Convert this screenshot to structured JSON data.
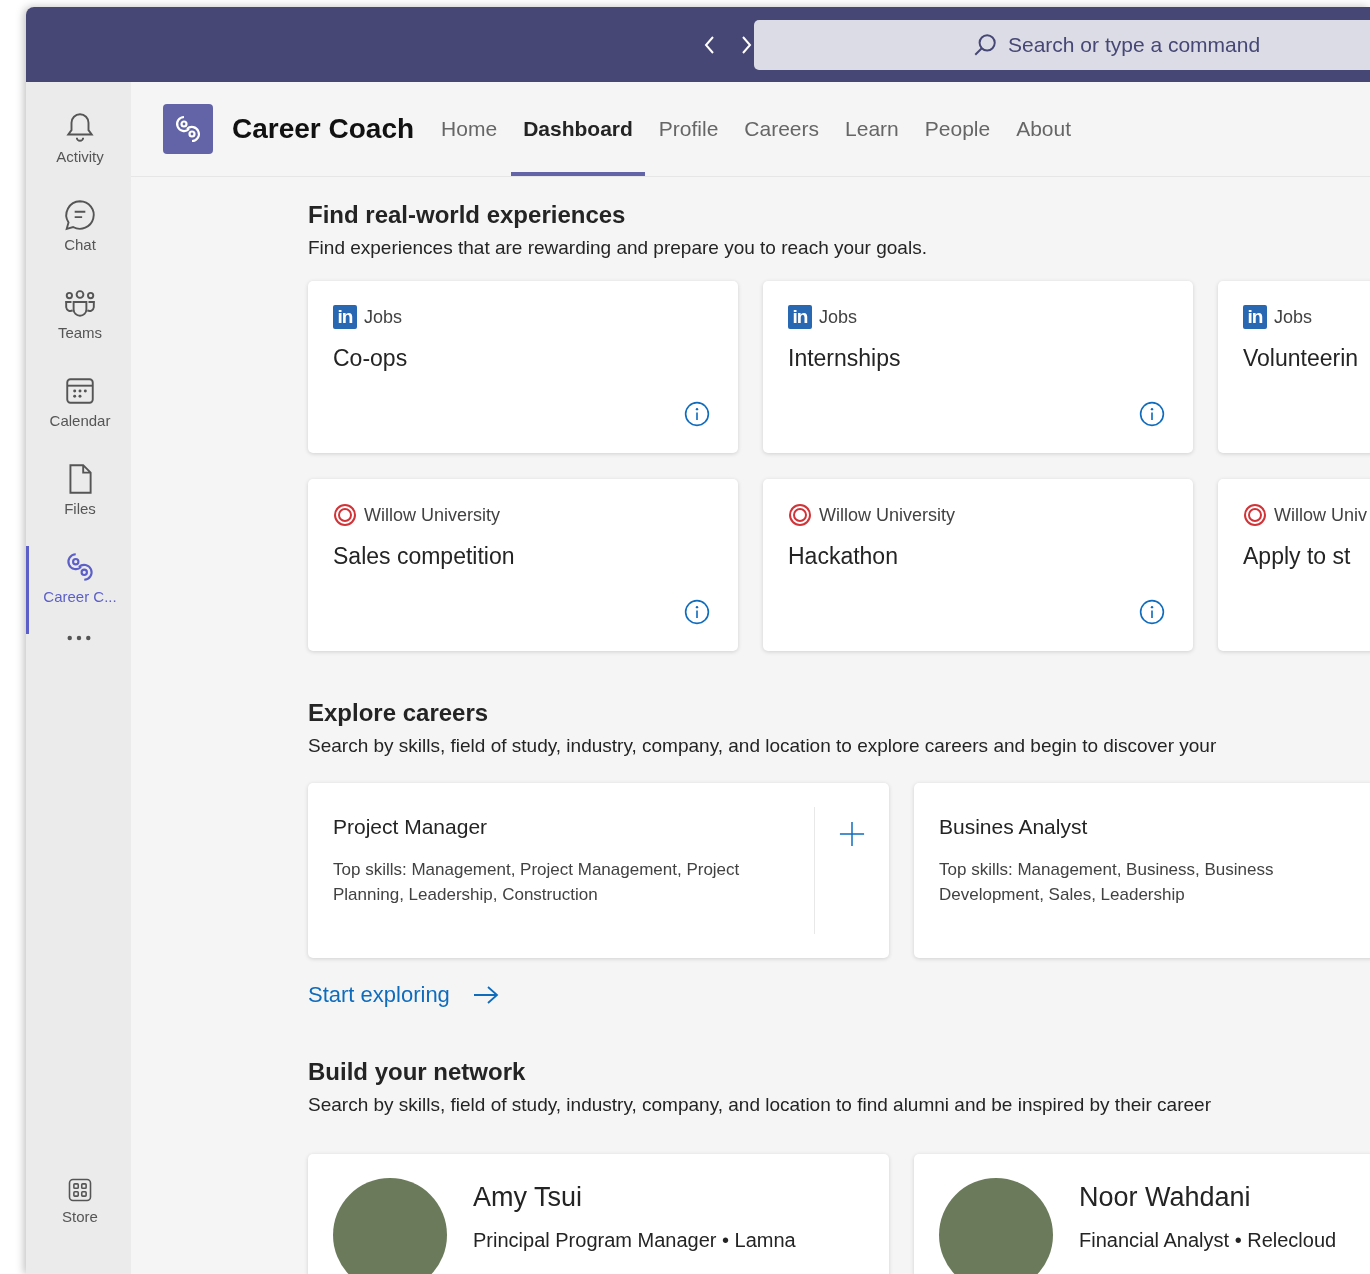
{
  "top_bar": {
    "search": {
      "placeholder": "Search or type a command"
    }
  },
  "rail": {
    "items": [
      {
        "label": "Activity",
        "selected": false
      },
      {
        "label": "Chat",
        "selected": false
      },
      {
        "label": "Teams",
        "selected": false
      },
      {
        "label": "Calendar",
        "selected": false
      },
      {
        "label": "Files",
        "selected": false
      },
      {
        "label": "Career C...",
        "selected": true
      }
    ],
    "bottom_items": [
      {
        "label": "Store",
        "selected": false
      }
    ]
  },
  "app": {
    "title": "Career Coach",
    "tabs": [
      {
        "label": "Home",
        "selected": false
      },
      {
        "label": "Dashboard",
        "selected": true
      },
      {
        "label": "Profile",
        "selected": false
      },
      {
        "label": "Careers",
        "selected": false
      },
      {
        "label": "Learn",
        "selected": false
      },
      {
        "label": "People",
        "selected": false
      },
      {
        "label": "About",
        "selected": false
      }
    ]
  },
  "experiences": {
    "title": "Find real-world experiences",
    "description": "Find experiences that are rewarding and prepare you to reach your goals.",
    "rows": [
      [
        {
          "kind": "linkedin",
          "badge": "in",
          "source": "Jobs",
          "title": "Co-ops",
          "info": true
        },
        {
          "kind": "linkedin",
          "badge": "in",
          "source": "Jobs",
          "title": "Internships",
          "info": true
        },
        {
          "kind": "linkedin",
          "badge": "in",
          "source": "Jobs",
          "title": "Volunteerin",
          "info": false
        }
      ],
      [
        {
          "kind": "university",
          "source": "Willow University",
          "title": "Sales competition",
          "info": true
        },
        {
          "kind": "university",
          "source": "Willow University",
          "title": "Hackathon",
          "info": true
        },
        {
          "kind": "university",
          "source": "Willow Univ",
          "title": "Apply to st",
          "info": false
        }
      ]
    ]
  },
  "careers": {
    "title": "Explore careers",
    "description": "Search by skills, field of study, industry, company, and location to explore careers and begin to discover your",
    "cards": [
      {
        "title": "Project Manager",
        "skills": "Top skills: Management, Project Management, Project Planning, Leadership, Construction",
        "add_button": true
      },
      {
        "title": "Busines Analyst",
        "skills": "Top skills: Management, Business, Business Development, Sales, Leadership",
        "add_button": false
      }
    ],
    "link": "Start exploring"
  },
  "network": {
    "title": "Build your network",
    "description": "Search by skills, field of study, industry, company, and location to find alumni and be inspired by their career",
    "people": [
      {
        "name": "Amy Tsui",
        "role": "Principal Program Manager • Lamna"
      },
      {
        "name": "Noor Wahdani",
        "role": "Financial Analyst • Relecloud"
      }
    ]
  }
}
